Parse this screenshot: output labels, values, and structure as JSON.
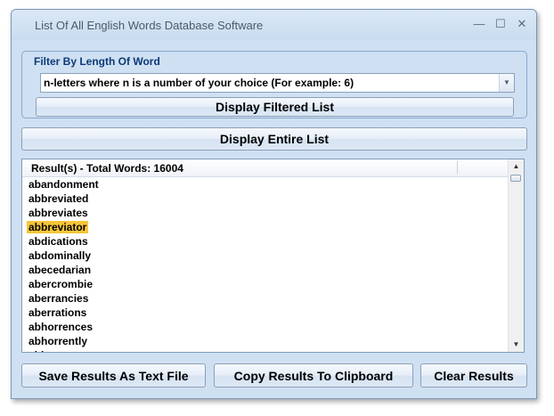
{
  "window": {
    "title": "List Of All English Words Database Software"
  },
  "titlebar_buttons": {
    "minimize": "—",
    "maximize": "☐",
    "close": "✕"
  },
  "filter": {
    "group_title": "Filter By Length Of Word",
    "combo_value": "n-letters where n is a number of your choice (For example: 6)",
    "display_filtered_label": "Display Filtered List"
  },
  "display_entire_label": "Display Entire List",
  "results": {
    "header": "Result(s) - Total Words: 16004",
    "rows": [
      "abandonment",
      "abbreviated",
      "abbreviates",
      "abbreviator",
      "abdications",
      "abdominally",
      "abecedarian",
      "abercrombie",
      "aberrancies",
      "aberrations",
      "abhorrences",
      "abhorrently",
      "abiogeneses"
    ],
    "selected_index": 3
  },
  "bottom_buttons": {
    "save_label": "Save Results As Text File",
    "copy_label": "Copy Results To Clipboard",
    "clear_label": "Clear Results"
  }
}
